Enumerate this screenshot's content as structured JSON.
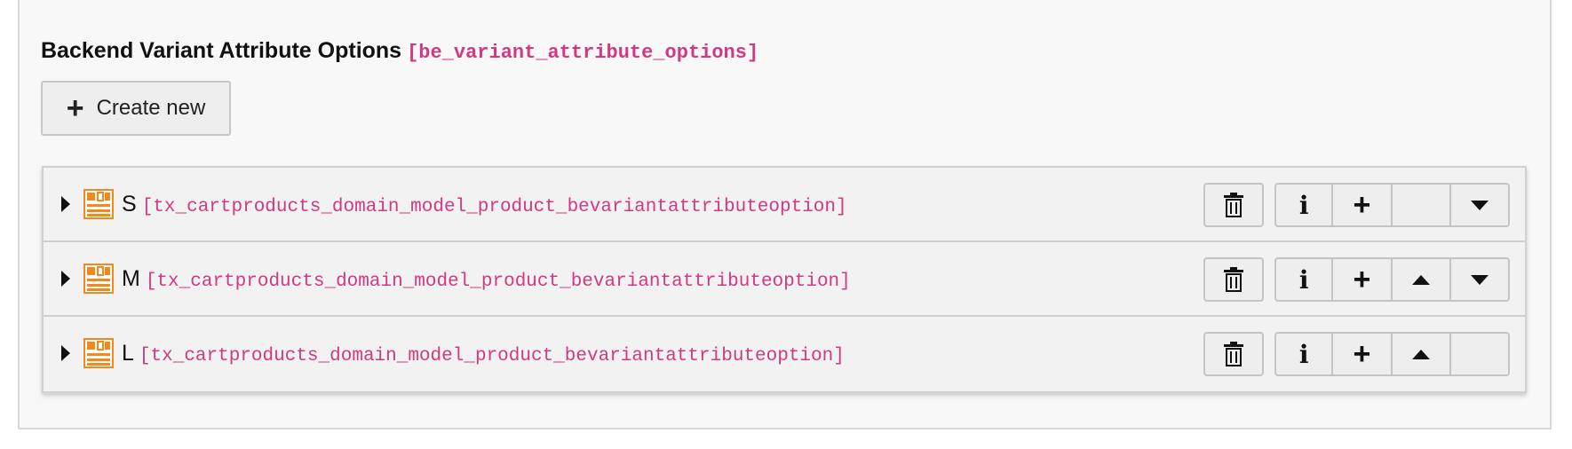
{
  "section": {
    "title": "Backend Variant Attribute Options",
    "table": "[be_variant_attribute_options]"
  },
  "create_button": {
    "icon": "plus-icon",
    "label": "Create new"
  },
  "records": [
    {
      "label": "S",
      "table": "[tx_cartproducts_domain_model_product_bevariantattributeoption]",
      "can_move_up": false,
      "can_move_down": true
    },
    {
      "label": "M",
      "table": "[tx_cartproducts_domain_model_product_bevariantattributeoption]",
      "can_move_up": true,
      "can_move_down": true
    },
    {
      "label": "L",
      "table": "[tx_cartproducts_domain_model_product_bevariantattributeoption]",
      "can_move_up": true,
      "can_move_down": false
    }
  ],
  "icons": {
    "expand": "caret-right-icon",
    "record": "record-icon",
    "delete": "trash-icon",
    "info": "info-icon",
    "add": "plus-icon",
    "up": "arrow-up-icon",
    "down": "arrow-down-icon"
  },
  "colors": {
    "accent_pink": "#d13a82",
    "record_icon_orange": "#f08a1c"
  }
}
